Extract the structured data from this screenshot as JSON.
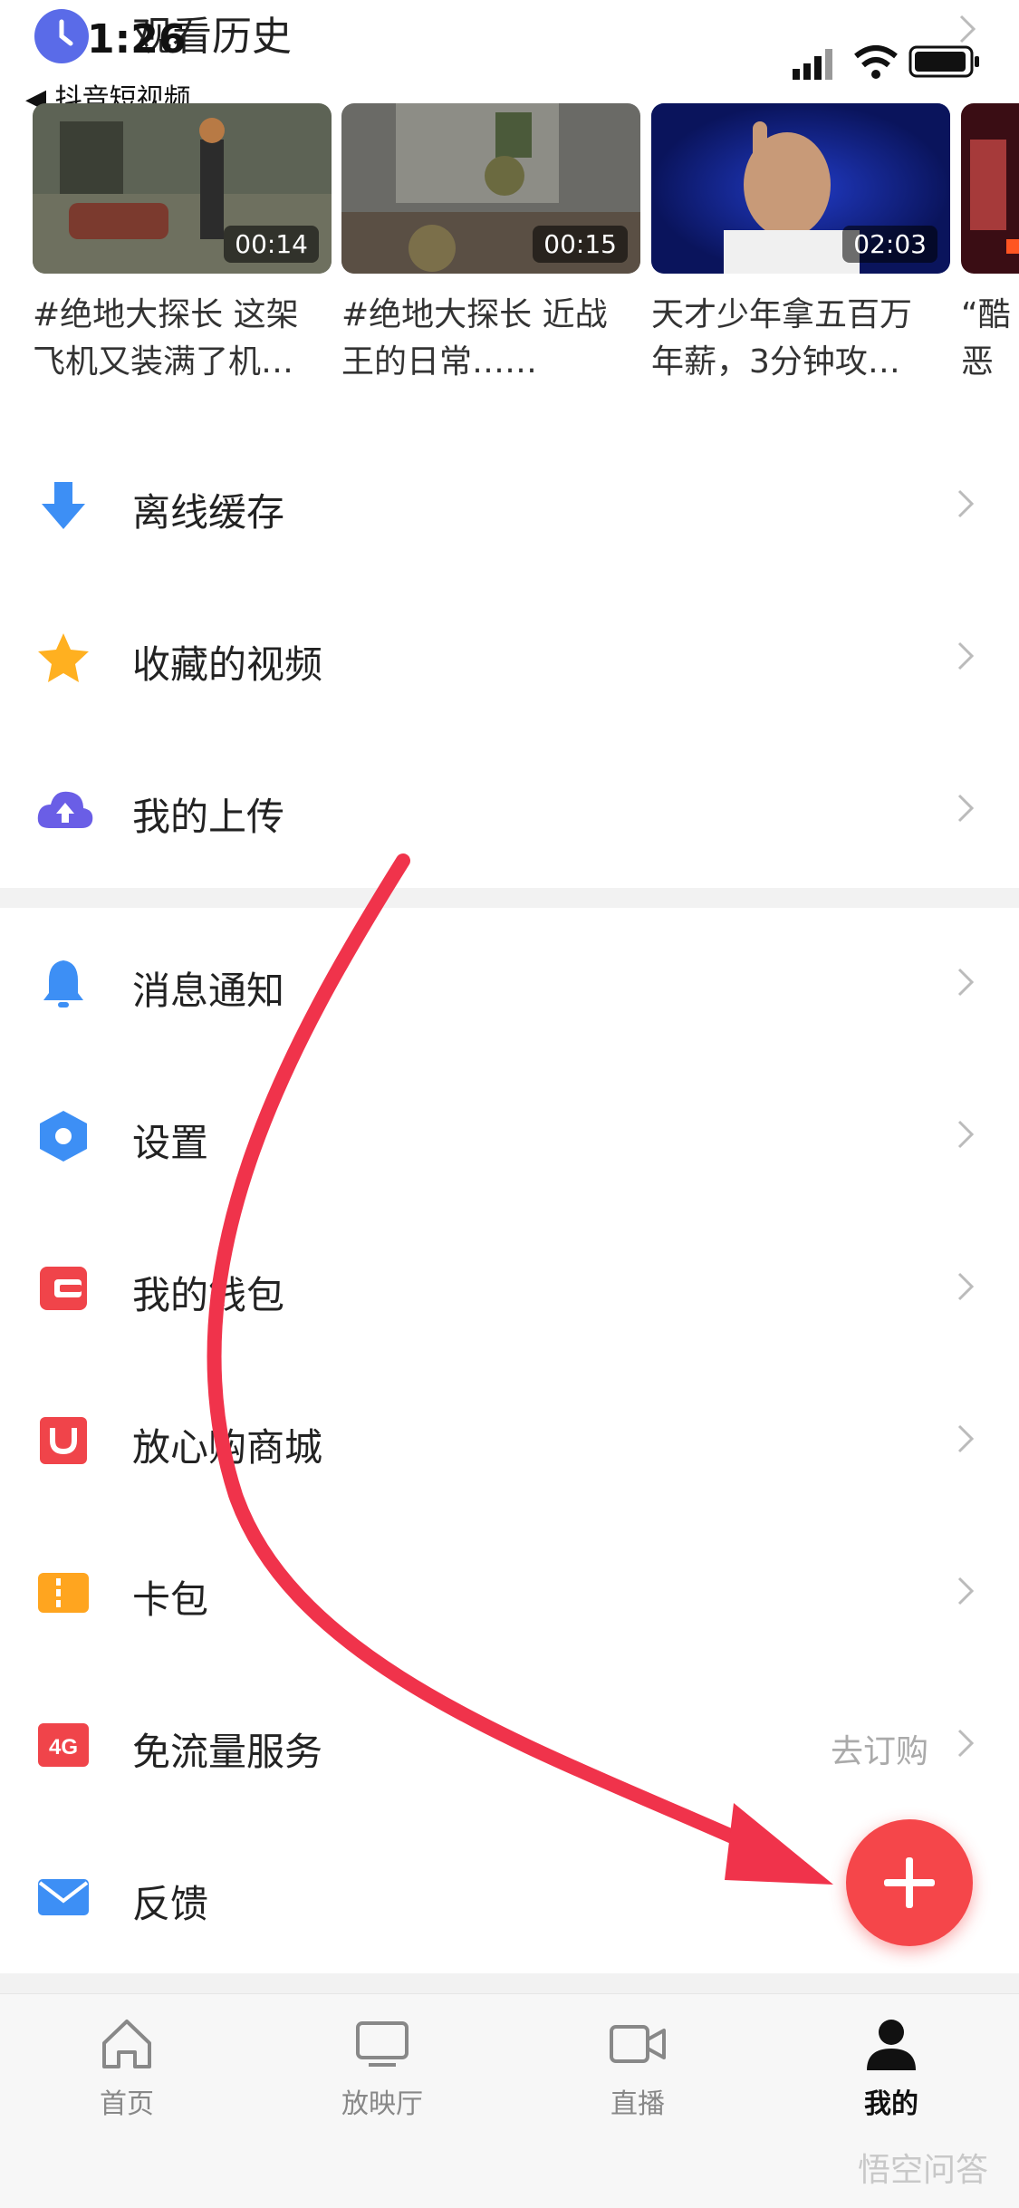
{
  "status_bar": {
    "time": "1:26",
    "back_app": "◀ 抖音短视频"
  },
  "history": {
    "title": "观看历史",
    "videos": [
      {
        "duration": "00:14",
        "caption": "#绝地大探长 这架\n飞机又装满了机…"
      },
      {
        "duration": "00:15",
        "caption": "#绝地大探长  近战\n王的日常……"
      },
      {
        "duration": "02:03",
        "caption": "天才少年拿五百万\n年薪，3分钟攻…"
      },
      {
        "duration": "",
        "caption": "“酷\n恶集"
      }
    ]
  },
  "menu_group_1": [
    {
      "label": "离线缓存",
      "icon": "download-icon"
    },
    {
      "label": "收藏的视频",
      "icon": "star-icon"
    },
    {
      "label": "我的上传",
      "icon": "cloud-upload-icon"
    }
  ],
  "menu_group_2": [
    {
      "label": "消息通知",
      "icon": "bell-icon"
    },
    {
      "label": "设置",
      "icon": "settings-hex-icon"
    },
    {
      "label": "我的钱包",
      "icon": "wallet-icon"
    },
    {
      "label": "放心购商城",
      "icon": "shopping-bag-icon"
    },
    {
      "label": "卡包",
      "icon": "card-pack-icon"
    },
    {
      "label": "免流量服务",
      "icon": "4g-icon",
      "extra": "去订购"
    },
    {
      "label": "反馈",
      "icon": "mail-icon"
    }
  ],
  "tabbar": [
    {
      "label": "首页",
      "icon": "home-icon"
    },
    {
      "label": "放映厅",
      "icon": "tv-icon"
    },
    {
      "label": "直播",
      "icon": "video-camera-icon"
    },
    {
      "label": "我的",
      "icon": "person-icon"
    }
  ],
  "watermark": "悟空问答",
  "colors": {
    "accent": "#f5464a",
    "arrow": "#f0334b"
  }
}
